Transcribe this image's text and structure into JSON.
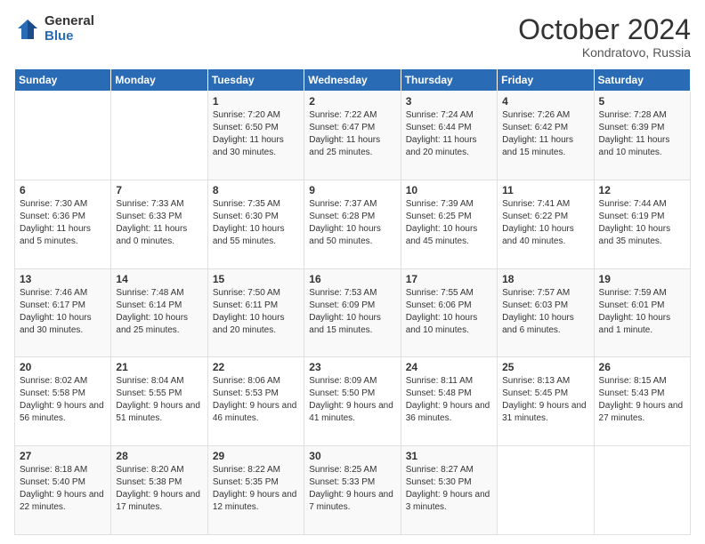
{
  "logo": {
    "general": "General",
    "blue": "Blue"
  },
  "header": {
    "month": "October 2024",
    "location": "Kondratovo, Russia"
  },
  "weekdays": [
    "Sunday",
    "Monday",
    "Tuesday",
    "Wednesday",
    "Thursday",
    "Friday",
    "Saturday"
  ],
  "weeks": [
    [
      {
        "day": "",
        "sunrise": "",
        "sunset": "",
        "daylight": ""
      },
      {
        "day": "",
        "sunrise": "",
        "sunset": "",
        "daylight": ""
      },
      {
        "day": "1",
        "sunrise": "Sunrise: 7:20 AM",
        "sunset": "Sunset: 6:50 PM",
        "daylight": "Daylight: 11 hours and 30 minutes."
      },
      {
        "day": "2",
        "sunrise": "Sunrise: 7:22 AM",
        "sunset": "Sunset: 6:47 PM",
        "daylight": "Daylight: 11 hours and 25 minutes."
      },
      {
        "day": "3",
        "sunrise": "Sunrise: 7:24 AM",
        "sunset": "Sunset: 6:44 PM",
        "daylight": "Daylight: 11 hours and 20 minutes."
      },
      {
        "day": "4",
        "sunrise": "Sunrise: 7:26 AM",
        "sunset": "Sunset: 6:42 PM",
        "daylight": "Daylight: 11 hours and 15 minutes."
      },
      {
        "day": "5",
        "sunrise": "Sunrise: 7:28 AM",
        "sunset": "Sunset: 6:39 PM",
        "daylight": "Daylight: 11 hours and 10 minutes."
      }
    ],
    [
      {
        "day": "6",
        "sunrise": "Sunrise: 7:30 AM",
        "sunset": "Sunset: 6:36 PM",
        "daylight": "Daylight: 11 hours and 5 minutes."
      },
      {
        "day": "7",
        "sunrise": "Sunrise: 7:33 AM",
        "sunset": "Sunset: 6:33 PM",
        "daylight": "Daylight: 11 hours and 0 minutes."
      },
      {
        "day": "8",
        "sunrise": "Sunrise: 7:35 AM",
        "sunset": "Sunset: 6:30 PM",
        "daylight": "Daylight: 10 hours and 55 minutes."
      },
      {
        "day": "9",
        "sunrise": "Sunrise: 7:37 AM",
        "sunset": "Sunset: 6:28 PM",
        "daylight": "Daylight: 10 hours and 50 minutes."
      },
      {
        "day": "10",
        "sunrise": "Sunrise: 7:39 AM",
        "sunset": "Sunset: 6:25 PM",
        "daylight": "Daylight: 10 hours and 45 minutes."
      },
      {
        "day": "11",
        "sunrise": "Sunrise: 7:41 AM",
        "sunset": "Sunset: 6:22 PM",
        "daylight": "Daylight: 10 hours and 40 minutes."
      },
      {
        "day": "12",
        "sunrise": "Sunrise: 7:44 AM",
        "sunset": "Sunset: 6:19 PM",
        "daylight": "Daylight: 10 hours and 35 minutes."
      }
    ],
    [
      {
        "day": "13",
        "sunrise": "Sunrise: 7:46 AM",
        "sunset": "Sunset: 6:17 PM",
        "daylight": "Daylight: 10 hours and 30 minutes."
      },
      {
        "day": "14",
        "sunrise": "Sunrise: 7:48 AM",
        "sunset": "Sunset: 6:14 PM",
        "daylight": "Daylight: 10 hours and 25 minutes."
      },
      {
        "day": "15",
        "sunrise": "Sunrise: 7:50 AM",
        "sunset": "Sunset: 6:11 PM",
        "daylight": "Daylight: 10 hours and 20 minutes."
      },
      {
        "day": "16",
        "sunrise": "Sunrise: 7:53 AM",
        "sunset": "Sunset: 6:09 PM",
        "daylight": "Daylight: 10 hours and 15 minutes."
      },
      {
        "day": "17",
        "sunrise": "Sunrise: 7:55 AM",
        "sunset": "Sunset: 6:06 PM",
        "daylight": "Daylight: 10 hours and 10 minutes."
      },
      {
        "day": "18",
        "sunrise": "Sunrise: 7:57 AM",
        "sunset": "Sunset: 6:03 PM",
        "daylight": "Daylight: 10 hours and 6 minutes."
      },
      {
        "day": "19",
        "sunrise": "Sunrise: 7:59 AM",
        "sunset": "Sunset: 6:01 PM",
        "daylight": "Daylight: 10 hours and 1 minute."
      }
    ],
    [
      {
        "day": "20",
        "sunrise": "Sunrise: 8:02 AM",
        "sunset": "Sunset: 5:58 PM",
        "daylight": "Daylight: 9 hours and 56 minutes."
      },
      {
        "day": "21",
        "sunrise": "Sunrise: 8:04 AM",
        "sunset": "Sunset: 5:55 PM",
        "daylight": "Daylight: 9 hours and 51 minutes."
      },
      {
        "day": "22",
        "sunrise": "Sunrise: 8:06 AM",
        "sunset": "Sunset: 5:53 PM",
        "daylight": "Daylight: 9 hours and 46 minutes."
      },
      {
        "day": "23",
        "sunrise": "Sunrise: 8:09 AM",
        "sunset": "Sunset: 5:50 PM",
        "daylight": "Daylight: 9 hours and 41 minutes."
      },
      {
        "day": "24",
        "sunrise": "Sunrise: 8:11 AM",
        "sunset": "Sunset: 5:48 PM",
        "daylight": "Daylight: 9 hours and 36 minutes."
      },
      {
        "day": "25",
        "sunrise": "Sunrise: 8:13 AM",
        "sunset": "Sunset: 5:45 PM",
        "daylight": "Daylight: 9 hours and 31 minutes."
      },
      {
        "day": "26",
        "sunrise": "Sunrise: 8:15 AM",
        "sunset": "Sunset: 5:43 PM",
        "daylight": "Daylight: 9 hours and 27 minutes."
      }
    ],
    [
      {
        "day": "27",
        "sunrise": "Sunrise: 8:18 AM",
        "sunset": "Sunset: 5:40 PM",
        "daylight": "Daylight: 9 hours and 22 minutes."
      },
      {
        "day": "28",
        "sunrise": "Sunrise: 8:20 AM",
        "sunset": "Sunset: 5:38 PM",
        "daylight": "Daylight: 9 hours and 17 minutes."
      },
      {
        "day": "29",
        "sunrise": "Sunrise: 8:22 AM",
        "sunset": "Sunset: 5:35 PM",
        "daylight": "Daylight: 9 hours and 12 minutes."
      },
      {
        "day": "30",
        "sunrise": "Sunrise: 8:25 AM",
        "sunset": "Sunset: 5:33 PM",
        "daylight": "Daylight: 9 hours and 7 minutes."
      },
      {
        "day": "31",
        "sunrise": "Sunrise: 8:27 AM",
        "sunset": "Sunset: 5:30 PM",
        "daylight": "Daylight: 9 hours and 3 minutes."
      },
      {
        "day": "",
        "sunrise": "",
        "sunset": "",
        "daylight": ""
      },
      {
        "day": "",
        "sunrise": "",
        "sunset": "",
        "daylight": ""
      }
    ]
  ]
}
